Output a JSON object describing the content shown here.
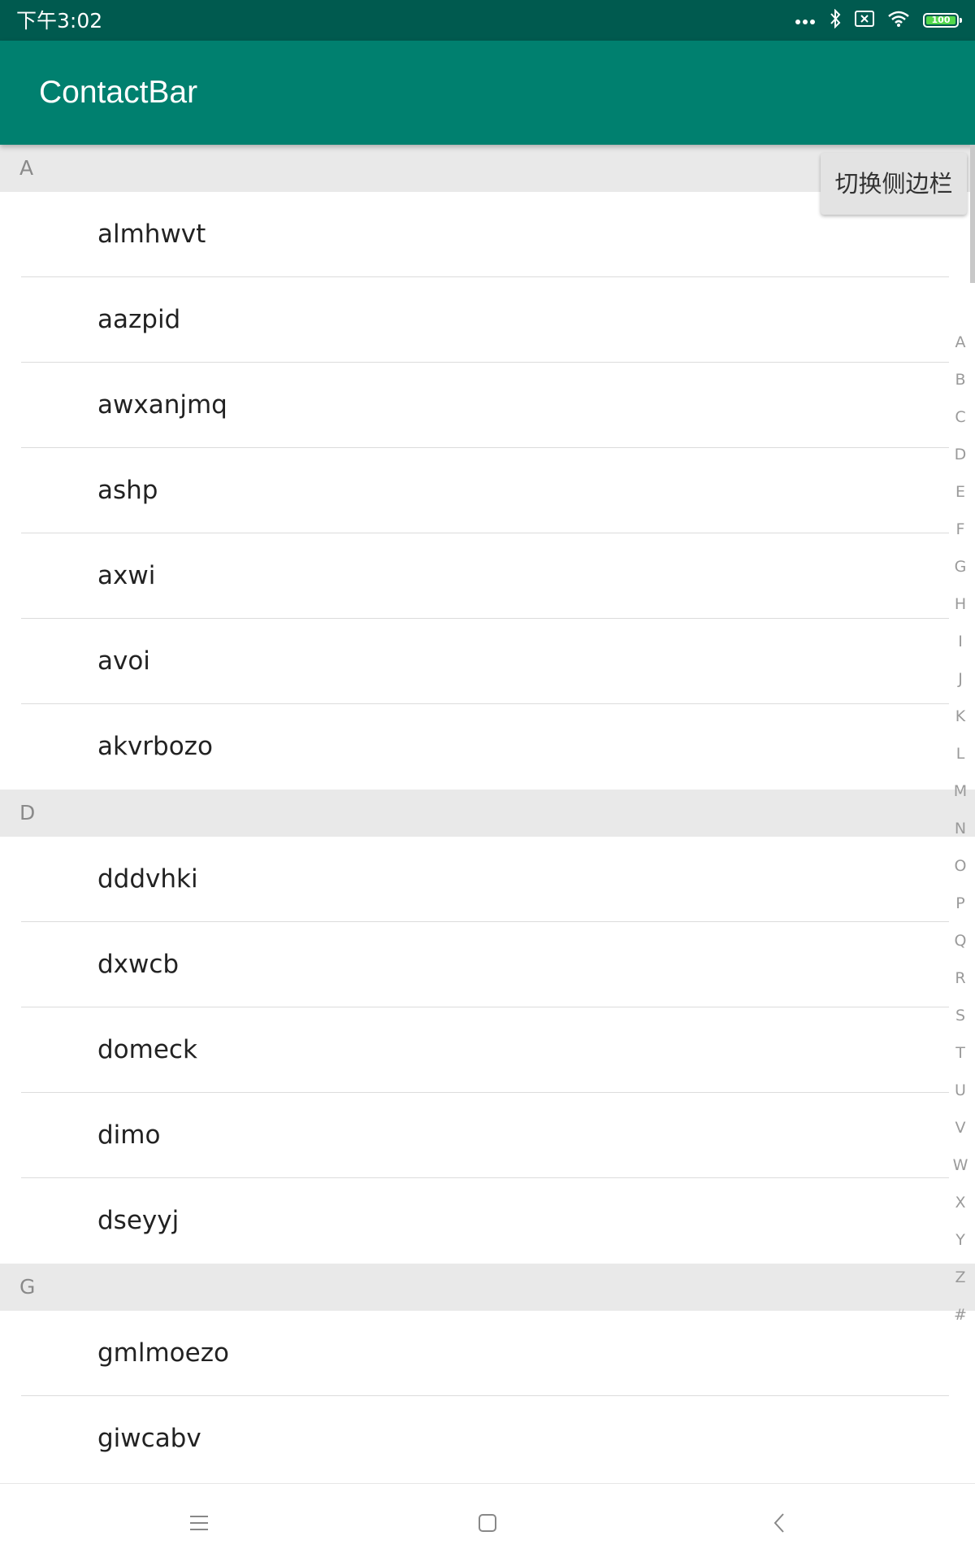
{
  "status_bar": {
    "time": "下午3:02",
    "battery_level": "100",
    "icons": [
      "more-dots-icon",
      "bluetooth-icon",
      "sim-off-icon",
      "wifi-icon",
      "battery-icon"
    ]
  },
  "app_bar": {
    "title": "ContactBar",
    "color": "#00806f"
  },
  "toggle_button": {
    "label": "切换侧边栏"
  },
  "sections": [
    {
      "letter": "A",
      "contacts": [
        "almhwvt",
        "aazpid",
        "awxanjmq",
        "ashp",
        "axwi",
        "avoi",
        "akvrbozo"
      ]
    },
    {
      "letter": "D",
      "contacts": [
        "dddvhki",
        "dxwcb",
        "domeck",
        "dimo",
        "dseyyj"
      ]
    },
    {
      "letter": "G",
      "contacts": [
        "gmlmoezo",
        "giwcabv"
      ]
    }
  ],
  "index_letters": [
    "A",
    "B",
    "C",
    "D",
    "E",
    "F",
    "G",
    "H",
    "I",
    "J",
    "K",
    "L",
    "M",
    "N",
    "O",
    "P",
    "Q",
    "R",
    "S",
    "T",
    "U",
    "V",
    "W",
    "X",
    "Y",
    "Z",
    "#"
  ],
  "nav_bar": {
    "icons": [
      "menu-icon",
      "home-icon",
      "back-icon"
    ]
  }
}
